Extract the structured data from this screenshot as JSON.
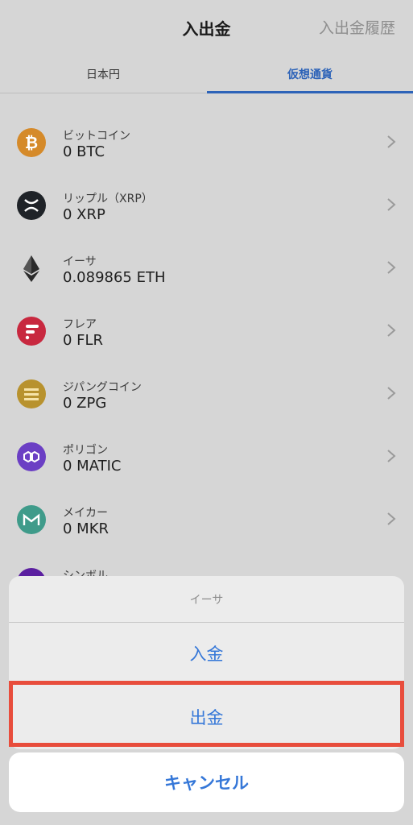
{
  "header": {
    "title": "入出金",
    "history_label": "入出金履歴"
  },
  "tabs": [
    {
      "label": "日本円",
      "active": false
    },
    {
      "label": "仮想通貨",
      "active": true
    }
  ],
  "colors": {
    "accent": "#2d63b8",
    "action_blue": "#3577d8",
    "highlight_red": "#e84d3c"
  },
  "coins": [
    {
      "name": "ビットコイン",
      "amount": "0 BTC",
      "icon": "bitcoin-icon",
      "color": "#d58a2a"
    },
    {
      "name": "リップル（XRP）",
      "amount": "0 XRP",
      "icon": "xrp-icon",
      "color": "#1f2328"
    },
    {
      "name": "イーサ",
      "amount": "0.089865 ETH",
      "icon": "ethereum-icon",
      "color": "#2b2b2b"
    },
    {
      "name": "フレア",
      "amount": "0 FLR",
      "icon": "flare-icon",
      "color": "#c8283f"
    },
    {
      "name": "ジパングコイン",
      "amount": "0 ZPG",
      "icon": "zipangcoin-icon",
      "color": "#b8922e"
    },
    {
      "name": "ポリゴン",
      "amount": "0 MATIC",
      "icon": "polygon-icon",
      "color": "#6b3fc4"
    },
    {
      "name": "メイカー",
      "amount": "0 MKR",
      "icon": "maker-icon",
      "color": "#3f9b8a"
    },
    {
      "name": "シンボル",
      "amount": "",
      "icon": "symbol-icon",
      "color": "#5b1fa0"
    }
  ],
  "action_sheet": {
    "title": "イーサ",
    "deposit_label": "入金",
    "withdraw_label": "出金",
    "cancel_label": "キャンセル"
  }
}
